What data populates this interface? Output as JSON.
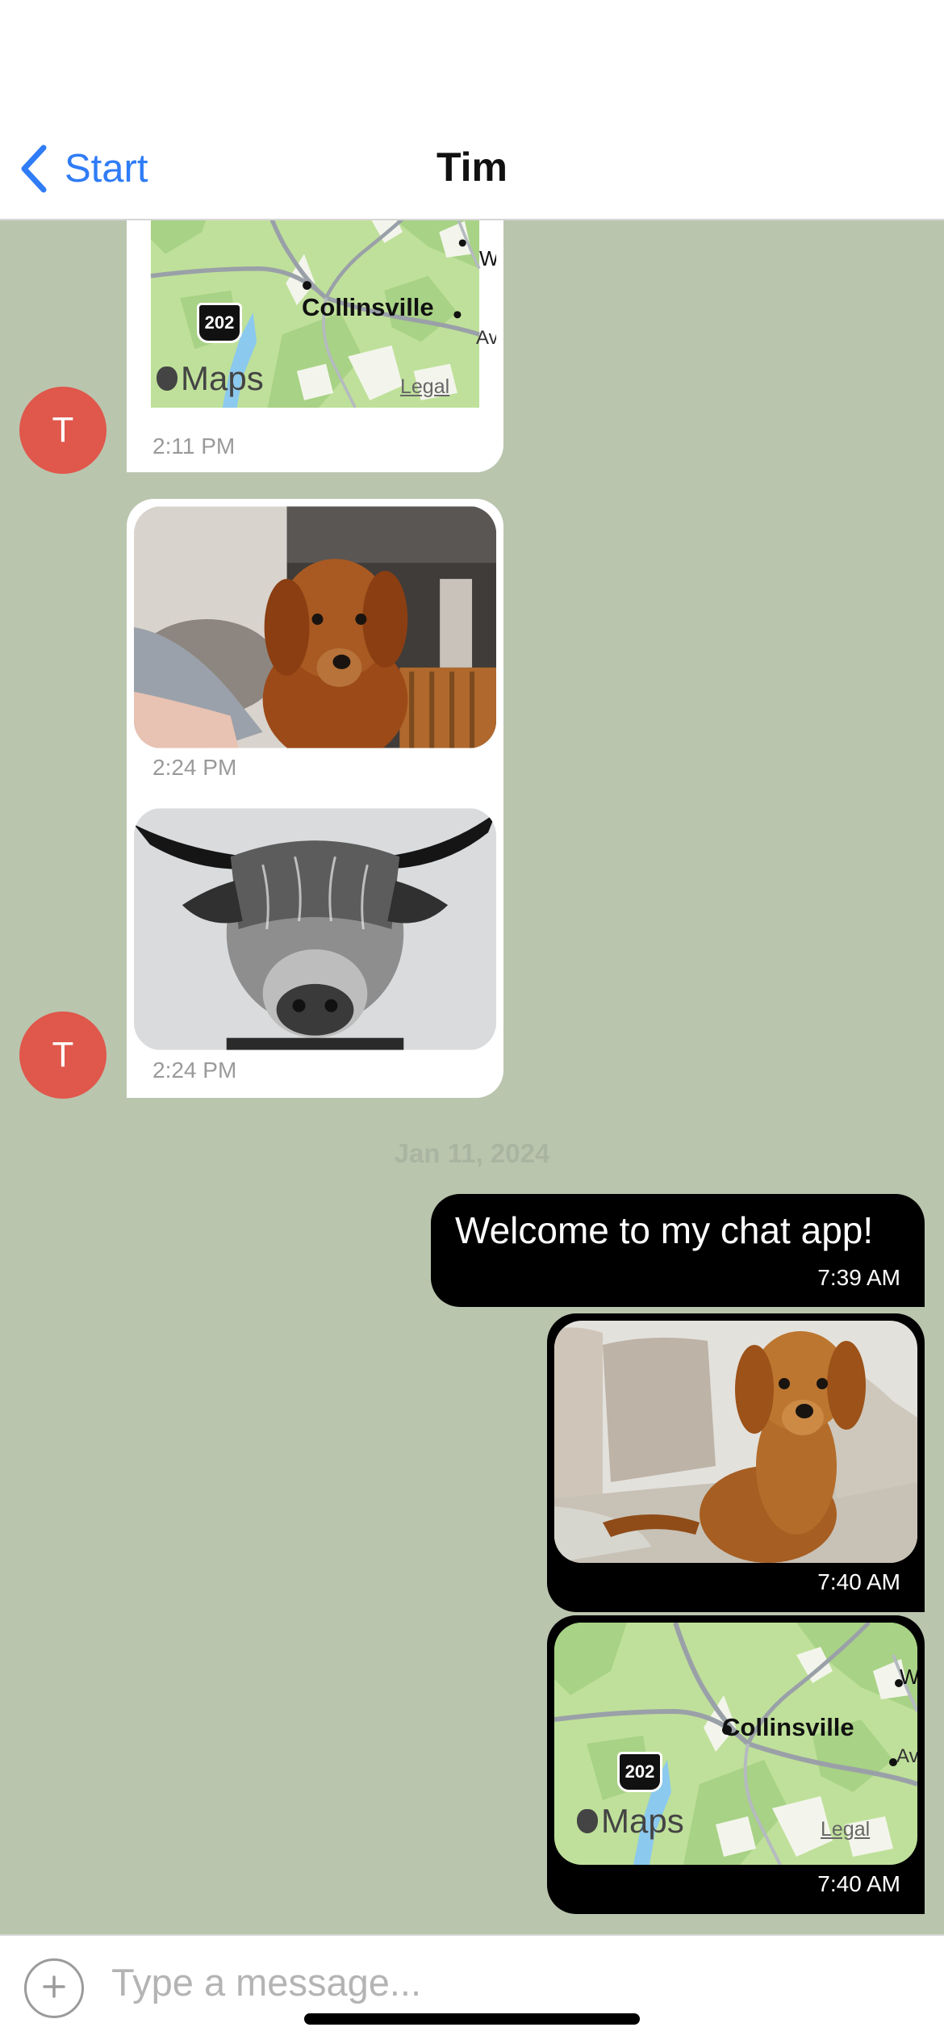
{
  "nav": {
    "back_label": "Start",
    "title": "Tim"
  },
  "contact": {
    "avatar_initial": "T",
    "avatar_color": "#e0574b"
  },
  "map_labels": {
    "place": "Collinsville",
    "route": "202",
    "brand": "Maps",
    "legal": "Legal",
    "edge_top": "W",
    "edge_bottom": "Av"
  },
  "messages": [
    {
      "direction": "incoming",
      "kind": "map",
      "time": "2:11 PM"
    },
    {
      "direction": "incoming",
      "kind": "photo",
      "subject": "golden retriever puppy",
      "time": "2:24 PM"
    },
    {
      "direction": "incoming",
      "kind": "photo",
      "subject": "highland cow",
      "time": "2:24 PM"
    },
    {
      "direction": "outgoing",
      "kind": "text",
      "text": "Welcome to my chat app!",
      "time": "7:39 AM"
    },
    {
      "direction": "outgoing",
      "kind": "photo",
      "subject": "golden retriever puppy on couch",
      "time": "7:40 AM"
    },
    {
      "direction": "outgoing",
      "kind": "map",
      "time": "7:40 AM"
    }
  ],
  "date_separator": "Jan 11, 2024",
  "composer": {
    "placeholder": "Type a message..."
  },
  "colors": {
    "chat_background": "#bac5ae",
    "incoming_bubble": "#ffffff",
    "outgoing_bubble": "#000000",
    "accent": "#2f7cf6"
  },
  "icons": {
    "back": "chevron-left-icon",
    "add": "plus-circle-icon",
    "brand": "apple-icon"
  }
}
